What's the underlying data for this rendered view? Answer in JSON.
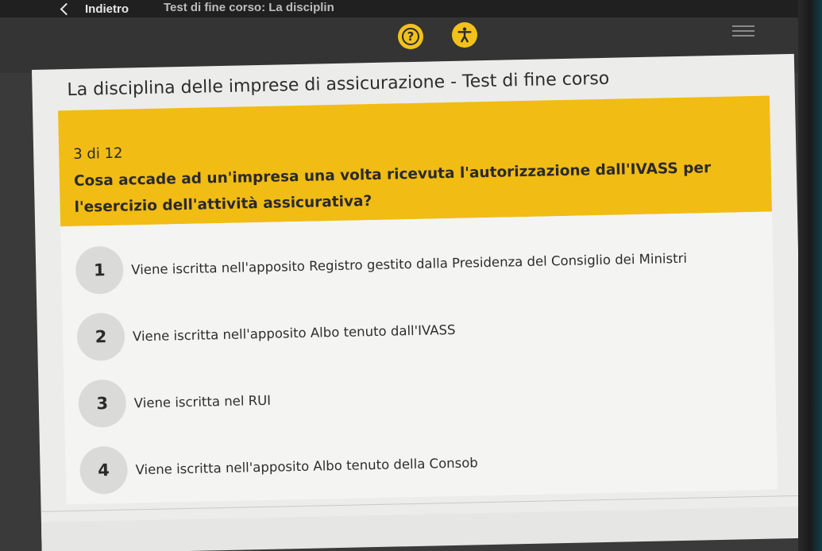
{
  "topbar": {
    "back_label": "Indietro",
    "course_title_small": "Test di fine corso: La disciplin"
  },
  "header": {
    "help_symbol": "?"
  },
  "course_title": "La disciplina delle imprese di assicurazione - Test di fine corso",
  "question": {
    "counter": "3 di 12",
    "text": "Cosa accade ad un'impresa una volta ricevuta l'autorizzazione dall'IVASS per l'esercizio dell'attività assicurativa?"
  },
  "answers": [
    {
      "number": "1",
      "text": "Viene iscritta nell'apposito Registro gestito dalla Presidenza del Consiglio dei Ministri"
    },
    {
      "number": "2",
      "text": "Viene iscritta nell'apposito Albo tenuto dall'IVASS"
    },
    {
      "number": "3",
      "text": "Viene iscritta nel RUI"
    },
    {
      "number": "4",
      "text": "Viene iscritta nell'apposito Albo tenuto della Consob"
    }
  ],
  "colors": {
    "accent": "#f1bc14",
    "background_dark": "#343434",
    "card_background": "#ececeb"
  },
  "icons": [
    "chevron-left-icon",
    "help-icon",
    "accessibility-icon",
    "menu-icon"
  ]
}
